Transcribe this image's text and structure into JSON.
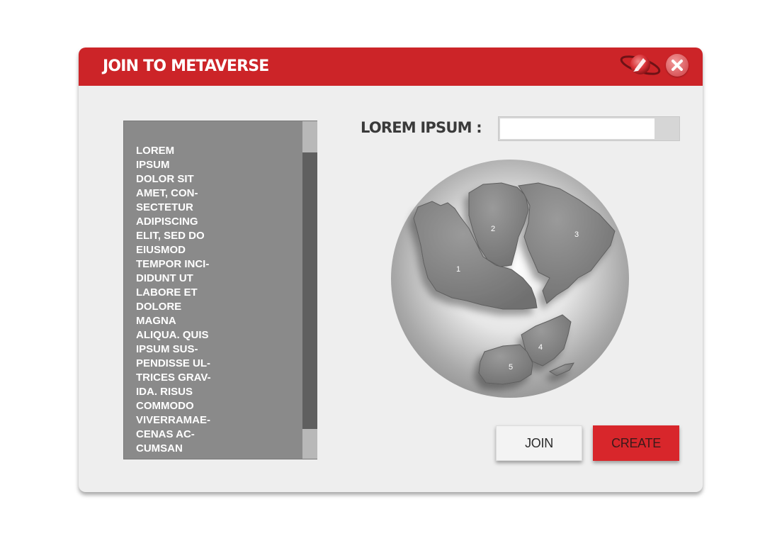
{
  "dialog": {
    "title": "JOIN TO METAVERSE",
    "logo_icon": "planet-rocket-icon",
    "close_icon": "close-icon"
  },
  "list": {
    "lines": [
      "LOREM",
      "IPSUM",
      "DOLOR SIT",
      "AMET, CON-",
      "SECTETUR",
      "ADIPISCING",
      "ELIT, SED DO",
      "EIUSMOD",
      "TEMPOR INCI-",
      "DIDUNT UT",
      "LABORE ET",
      "DOLORE",
      "MAGNA",
      "ALIQUA. QUIS",
      "IPSUM SUS-",
      "PENDISSE UL-",
      "TRICES GRAV-",
      "IDA. RISUS",
      "COMMODO",
      "VIVERRAMAE-",
      "CENAS AC-",
      "CUMSAN"
    ]
  },
  "field": {
    "label": "LOREM IPSUM :",
    "value": ""
  },
  "map": {
    "regions": [
      "1",
      "2",
      "3",
      "4",
      "5"
    ]
  },
  "buttons": {
    "join": "JOIN",
    "create": "CREATE"
  },
  "colors": {
    "accent": "#cc2428",
    "create_button": "#d8262b",
    "panel": "#8a8a8a",
    "background": "#eeeeee"
  }
}
